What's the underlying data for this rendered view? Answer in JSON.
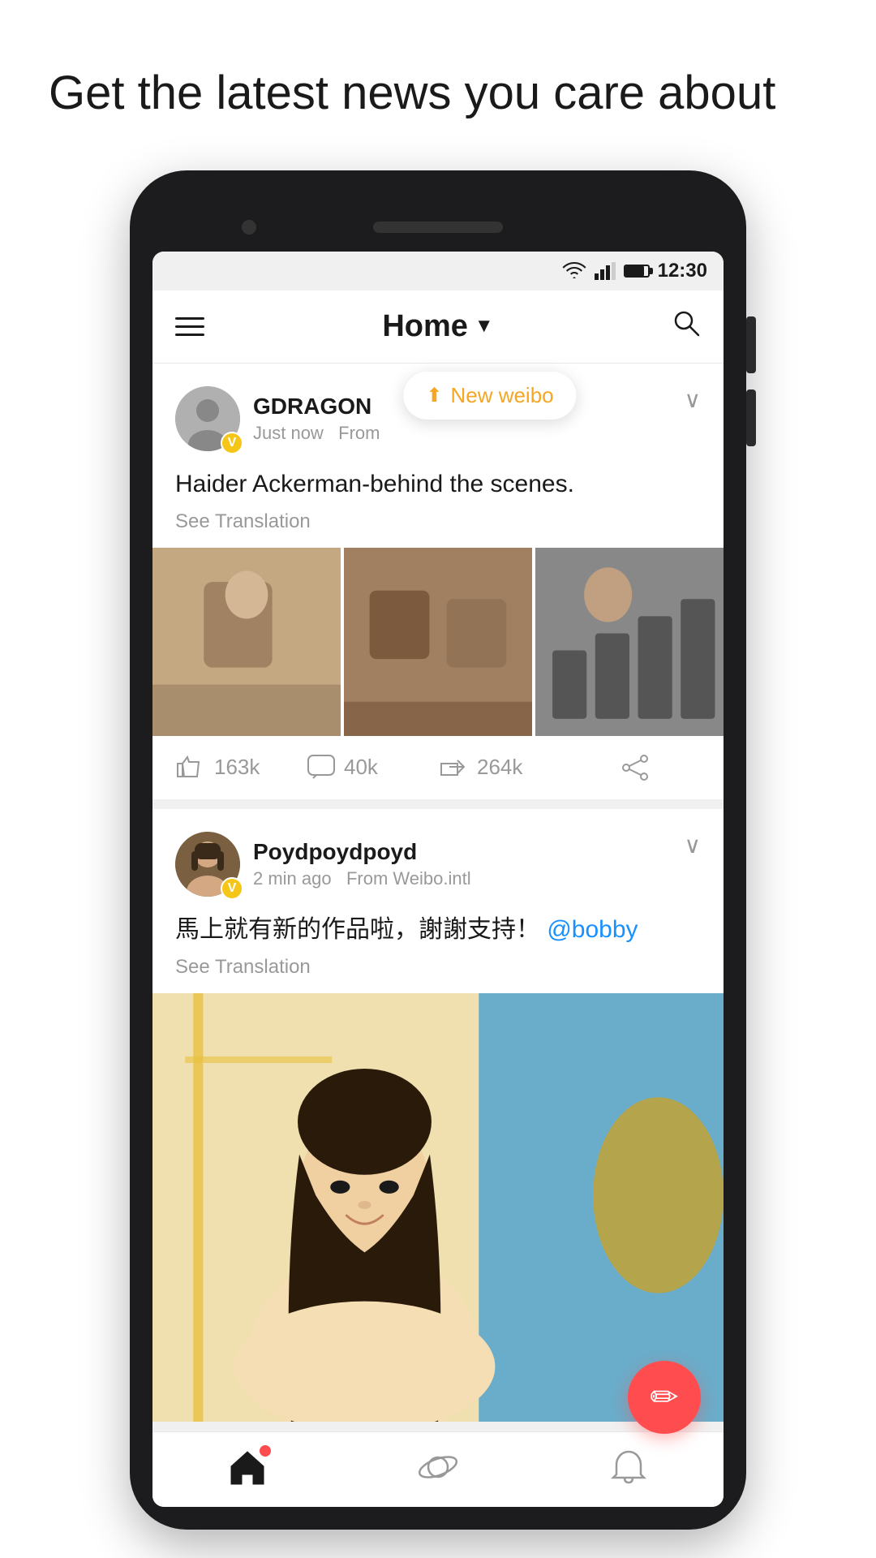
{
  "page": {
    "headline": "Get the latest news you care about"
  },
  "status_bar": {
    "time": "12:30"
  },
  "header": {
    "title": "Home",
    "menu_label": "Menu",
    "search_label": "Search"
  },
  "toast": {
    "label": "New weibo"
  },
  "posts": [
    {
      "id": "post-1",
      "author": "GDRAGON",
      "timestamp": "Just now",
      "source": "From",
      "badge": "V",
      "text": "Haider Ackerman-behind the scenes.",
      "see_translation": "See Translation",
      "likes": "163k",
      "comments": "40k",
      "reposts": "264k",
      "images": [
        "img1",
        "img2",
        "img3"
      ]
    },
    {
      "id": "post-2",
      "author": "Poydpoydpoyd",
      "timestamp": "2 min ago",
      "source": "From Weibo.intl",
      "badge": "V",
      "text": "馬上就有新的作品啦，謝謝支持！",
      "mention": "@bobby",
      "see_translation": "See Translation",
      "images": [
        "img4"
      ]
    }
  ],
  "bottom_nav": {
    "home_label": "Home",
    "discover_label": "Discover",
    "notifications_label": "Notifications"
  },
  "fab": {
    "label": "Compose"
  }
}
